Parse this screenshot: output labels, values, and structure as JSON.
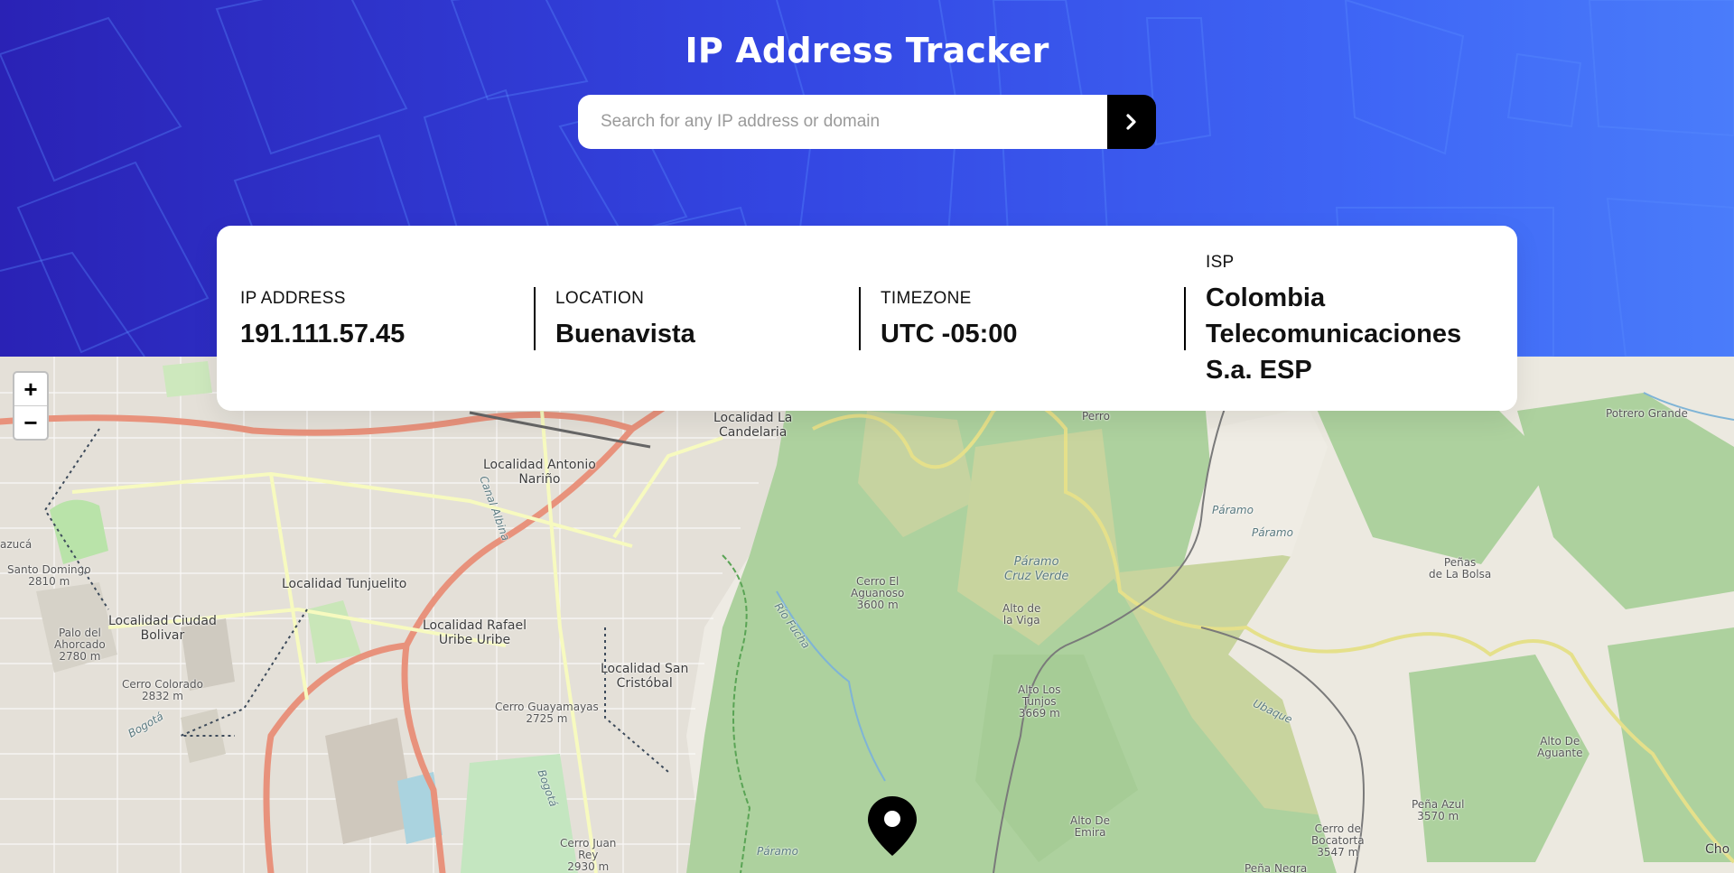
{
  "header": {
    "title": "IP Address Tracker",
    "search_placeholder": "Search for any IP address or domain",
    "search_value": "",
    "submit_icon": "chevron-right-icon"
  },
  "info": {
    "ip": {
      "label": "IP ADDRESS",
      "value": "191.111.57.45"
    },
    "location": {
      "label": "LOCATION",
      "value": "Buenavista"
    },
    "timezone": {
      "label": "TIMEZONE",
      "value": "UTC -05:00"
    },
    "isp": {
      "label": "ISP",
      "value_lines": [
        "Colombia",
        "Telecomunicaciones",
        "S.a. ESP"
      ]
    }
  },
  "map": {
    "zoom_in": "+",
    "zoom_out": "−",
    "marker_icon": "location-pin-icon",
    "labels": {
      "candelaria": [
        "Localidad La",
        "Candelaria"
      ],
      "antonio_narino": [
        "Localidad Antonio",
        "Nariño"
      ],
      "tunjuelito": "Localidad Tunjuelito",
      "ciudad_bolivar": [
        "Localidad Ciudad",
        "Bolivar"
      ],
      "rafael_uribe": [
        "Localidad Rafael",
        "Uribe Uribe"
      ],
      "san_cristobal": [
        "Localidad San",
        "Cristóbal"
      ],
      "santo_domingo": [
        "Santo Domingo",
        "2810 m"
      ],
      "azuca": "azucá",
      "palo_ahorcado": [
        "Palo del",
        "Ahorcado",
        "2780 m"
      ],
      "cerro_colorado": [
        "Cerro Colorado",
        "2832 m"
      ],
      "guayamayas": [
        "Cerro Guayamayas",
        "2725 m"
      ],
      "cerro_juan_rey": [
        "Cerro Juan",
        "Rey",
        "2930 m"
      ],
      "cerro_aguanoso": [
        "Cerro El",
        "Aguanoso",
        "3600 m"
      ],
      "paramo_cruz_verde": [
        "Páramo",
        "Cruz Verde"
      ],
      "alto_viga": [
        "Alto de",
        "la Viga"
      ],
      "alto_tunjos": [
        "Alto Los",
        "Tunjos",
        "3669 m"
      ],
      "perro": "Perro",
      "potrero_grande": "Potrero Grande",
      "paramo1": "Páramo",
      "paramo2": "Páramo",
      "paramo3": "Páramo",
      "penas_bolsa": [
        "Peñas",
        "de La Bolsa"
      ],
      "ubaque": "Ubaque",
      "alto_aguante": [
        "Alto De",
        "Aguante"
      ],
      "pena_azul": [
        "Peña Azul",
        "3570 m"
      ],
      "cerro_bocatorta": [
        "Cerro de",
        "Bocatorta",
        "3547 m"
      ],
      "alto_emira": [
        "Alto De",
        "Emira"
      ],
      "pena_negra": "Peña Negra",
      "cho": "Cho",
      "rio_bogota1": "Bogotá",
      "rio_bogota2": "Bogotá",
      "canal_albina": "Canal Albina",
      "rio_fucha": "Río Fucha"
    }
  }
}
